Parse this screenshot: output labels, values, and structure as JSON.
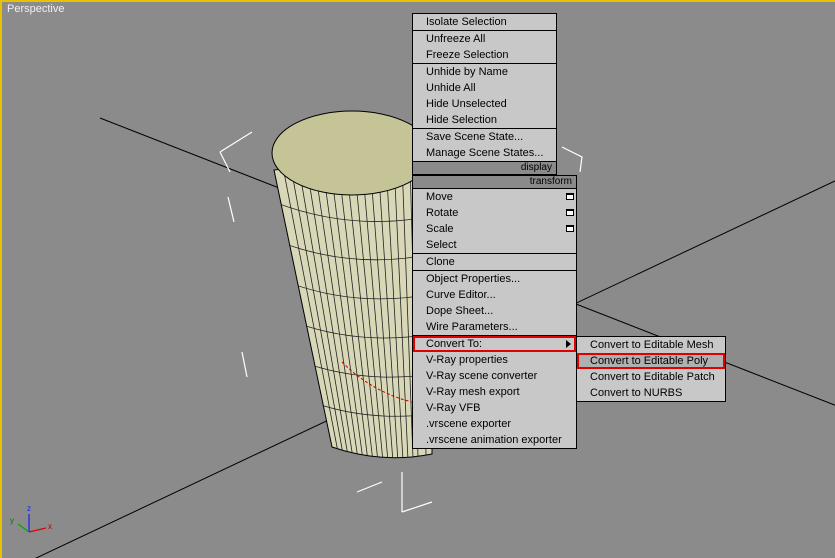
{
  "viewport": {
    "label": "Perspective"
  },
  "gizmo": {
    "z": "z",
    "y": "y",
    "x": "x"
  },
  "display_menu": {
    "items": [
      {
        "label": "Isolate Selection"
      },
      {
        "label": "Unfreeze All"
      },
      {
        "label": "Freeze Selection"
      },
      {
        "label": "Unhide by Name"
      },
      {
        "label": "Unhide All"
      },
      {
        "label": "Hide Unselected"
      },
      {
        "label": "Hide Selection"
      },
      {
        "label": "Save Scene State..."
      },
      {
        "label": "Manage Scene States..."
      }
    ],
    "header": "display"
  },
  "transform_menu": {
    "header": "transform",
    "items": [
      {
        "label": "Move"
      },
      {
        "label": "Rotate"
      },
      {
        "label": "Scale"
      },
      {
        "label": "Select"
      },
      {
        "label": "Clone"
      },
      {
        "label": "Object Properties..."
      },
      {
        "label": "Curve Editor..."
      },
      {
        "label": "Dope Sheet..."
      },
      {
        "label": "Wire Parameters..."
      },
      {
        "label": "Convert To:"
      },
      {
        "label": "V-Ray properties"
      },
      {
        "label": "V-Ray scene converter"
      },
      {
        "label": "V-Ray mesh export"
      },
      {
        "label": "V-Ray VFB"
      },
      {
        "label": ".vrscene exporter"
      },
      {
        "label": ".vrscene animation exporter"
      }
    ]
  },
  "convert_submenu": {
    "items": [
      {
        "label": "Convert to Editable Mesh"
      },
      {
        "label": "Convert to Editable Poly"
      },
      {
        "label": "Convert to Editable Patch"
      },
      {
        "label": "Convert to NURBS"
      }
    ]
  }
}
